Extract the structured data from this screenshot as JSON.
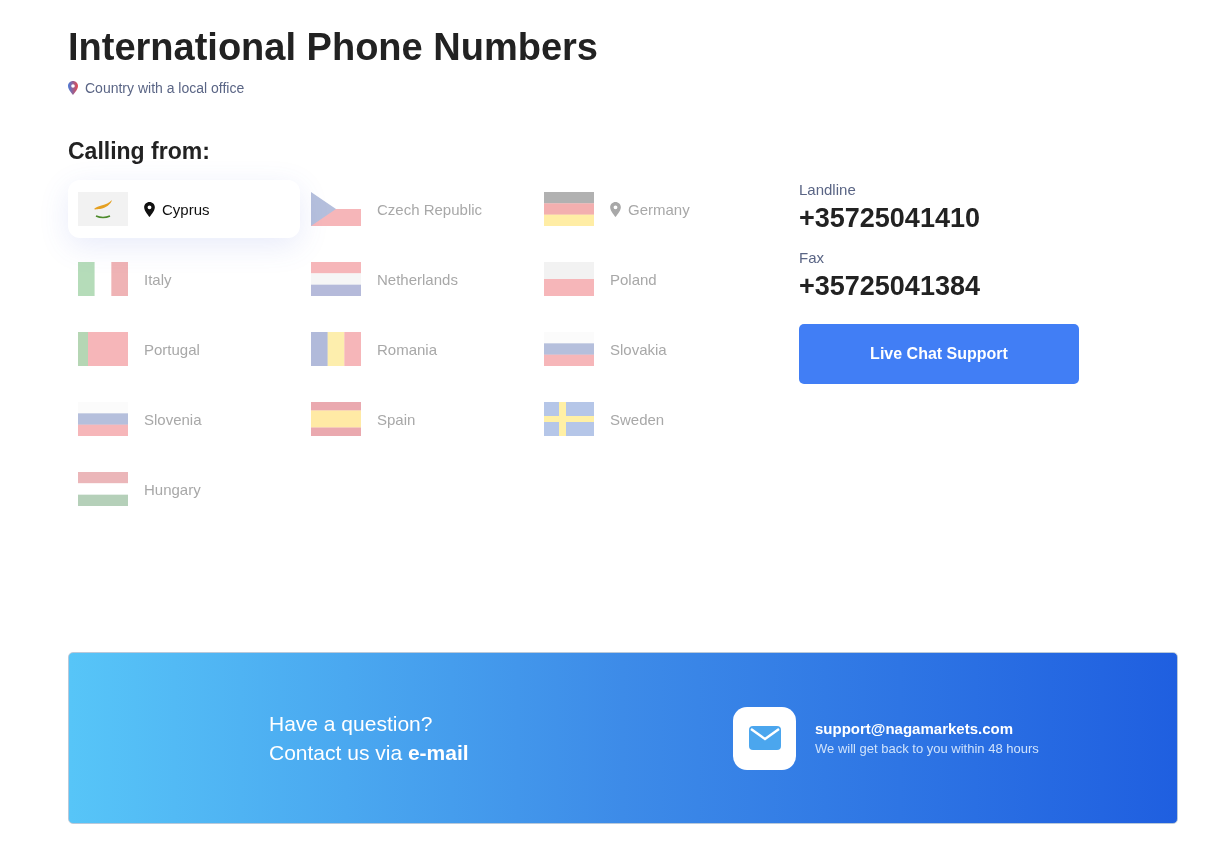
{
  "title": "International Phone Numbers",
  "legend": {
    "label": "Country with a local office"
  },
  "calling_from": {
    "heading": "Calling from:"
  },
  "countries": [
    {
      "name": "Cyprus",
      "selected": true,
      "local_office": true
    },
    {
      "name": "Czech Republic",
      "selected": false,
      "local_office": false
    },
    {
      "name": "Germany",
      "selected": false,
      "local_office": true
    },
    {
      "name": "Italy",
      "selected": false,
      "local_office": false
    },
    {
      "name": "Netherlands",
      "selected": false,
      "local_office": false
    },
    {
      "name": "Poland",
      "selected": false,
      "local_office": false
    },
    {
      "name": "Portugal",
      "selected": false,
      "local_office": false
    },
    {
      "name": "Romania",
      "selected": false,
      "local_office": false
    },
    {
      "name": "Slovakia",
      "selected": false,
      "local_office": false
    },
    {
      "name": "Slovenia",
      "selected": false,
      "local_office": false
    },
    {
      "name": "Spain",
      "selected": false,
      "local_office": false
    },
    {
      "name": "Sweden",
      "selected": false,
      "local_office": false
    },
    {
      "name": "Hungary",
      "selected": false,
      "local_office": false
    }
  ],
  "contact": {
    "numbers": [
      {
        "label": "Landline",
        "value": "+35725041410"
      },
      {
        "label": "Fax",
        "value": "+35725041384"
      }
    ],
    "button": "Live Chat Support"
  },
  "banner": {
    "line1": "Have a question?",
    "line2": "Contact us via **e-mail**",
    "email": "support@nagamarkets.com",
    "note": "We will get back to you within 48 hours"
  }
}
